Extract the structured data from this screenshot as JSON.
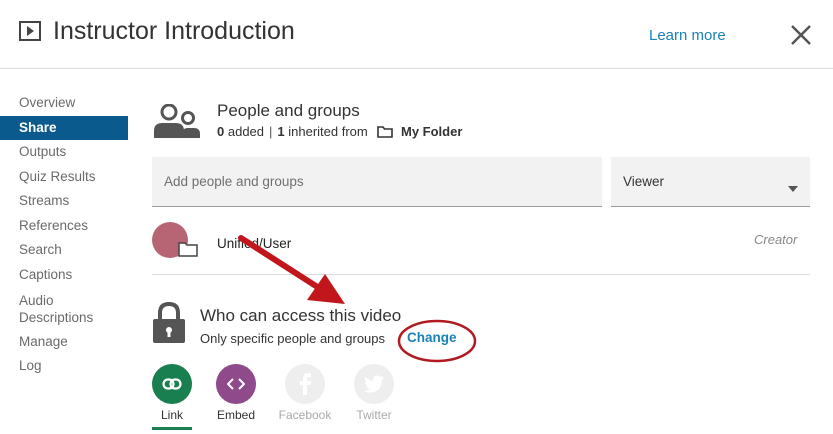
{
  "header": {
    "title": "Instructor Introduction",
    "learn_more": "Learn more",
    "close_icon": "close-icon"
  },
  "sidebar": {
    "items": [
      {
        "label": "Overview",
        "active": false
      },
      {
        "label": "Share",
        "active": true
      },
      {
        "label": "Outputs",
        "active": false
      },
      {
        "label": "Quiz Results",
        "active": false
      },
      {
        "label": "Streams",
        "active": false
      },
      {
        "label": "References",
        "active": false
      },
      {
        "label": "Search",
        "active": false
      },
      {
        "label": "Captions",
        "active": false
      },
      {
        "label": "Audio\nDescriptions",
        "active": false
      },
      {
        "label": "Manage",
        "active": false
      },
      {
        "label": "Log",
        "active": false
      }
    ]
  },
  "people": {
    "title": "People and groups",
    "added_count": "0",
    "added_text": "added",
    "inherited_count": "1",
    "inherited_text": "inherited from",
    "folder_name": "My Folder",
    "input_placeholder": "Add people and groups",
    "role_select": "Viewer",
    "members": [
      {
        "name": "Unified/User",
        "role": "Creator",
        "avatar_color": "#b76574"
      }
    ]
  },
  "access": {
    "title": "Who can access this video",
    "subtitle": "Only specific people and groups",
    "change_label": "Change"
  },
  "share": {
    "buttons": [
      {
        "label": "Link",
        "icon": "link-icon",
        "color": "#1a7f50",
        "enabled": true
      },
      {
        "label": "Embed",
        "icon": "embed-icon",
        "color": "#8e4a8a",
        "enabled": true
      },
      {
        "label": "Facebook",
        "icon": "facebook-icon",
        "color": "#eeeeee",
        "enabled": false
      },
      {
        "label": "Twitter",
        "icon": "twitter-icon",
        "color": "#eeeeee",
        "enabled": false
      }
    ]
  },
  "colors": {
    "accent": "#1a82b4",
    "nav_active": "#0b5a8e",
    "annotation_red": "#c0161c"
  }
}
